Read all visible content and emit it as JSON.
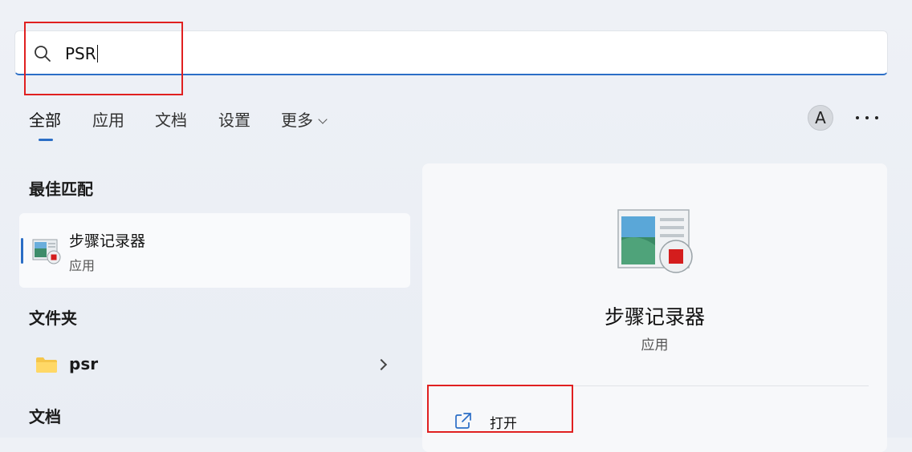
{
  "search": {
    "query": "PSR"
  },
  "tabs": [
    {
      "label": "全部",
      "active": true
    },
    {
      "label": "应用"
    },
    {
      "label": "文档"
    },
    {
      "label": "设置"
    },
    {
      "label": "更多"
    }
  ],
  "header": {
    "avatar_letter": "A"
  },
  "best_match": {
    "section_title": "最佳匹配",
    "name": "步骤记录器",
    "type": "应用"
  },
  "folders": {
    "section_title": "文件夹",
    "items": [
      {
        "name": "psr"
      }
    ]
  },
  "documents": {
    "section_title": "文档"
  },
  "detail": {
    "name": "步骤记录器",
    "type": "应用",
    "actions": [
      {
        "label": "打开"
      }
    ]
  },
  "colors": {
    "accent": "#2b6ec6",
    "highlight": "#e02020"
  },
  "icons": [
    "search-icon",
    "chevron-down-icon",
    "more-icon",
    "steps-recorder-icon",
    "folder-icon",
    "chevron-right-icon",
    "open-external-icon"
  ]
}
